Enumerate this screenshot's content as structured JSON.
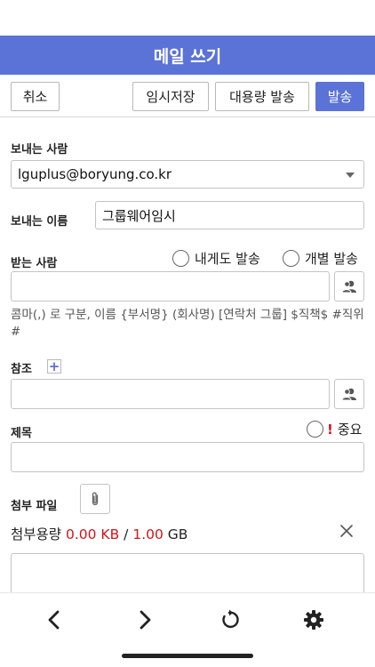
{
  "header": {
    "title": "메일 쓰기"
  },
  "toolbar": {
    "cancel_label": "취소",
    "draft_label": "임시저장",
    "bulk_send_label": "대용량 발송",
    "send_label": "발송"
  },
  "form": {
    "sender_label": "보내는 사람",
    "sender_value": "lguplus@boryung.co.kr",
    "sender_name_label": "보내는 이름",
    "sender_name_value": "그룹웨어임시",
    "recipient_label": "받는 사람",
    "send_to_me_label": "내게도 발송",
    "individual_send_label": "개별 발송",
    "recipient_value": "",
    "recipient_hint": "콤마(,) 로 구분, 이름 {부서명} (회사명) [연락처 그룹] $직책$ #직위#",
    "cc_label": "참조",
    "cc_add_symbol": "+",
    "cc_value": "",
    "subject_label": "제목",
    "important_mark": "!",
    "important_label": "중요",
    "subject_value": "",
    "attachment_label": "첨부 파일",
    "attachment_quota": {
      "label": "첨부용량",
      "used": "0.00 KB",
      "separator": "/",
      "limit": "1.00",
      "unit": "GB"
    },
    "body_value": ""
  },
  "icons": {
    "recipient_picker": "address-book-icon",
    "cc_picker": "address-book-icon",
    "attach": "paperclip-icon",
    "clear": "close-icon",
    "nav_back": "chevron-left-icon",
    "nav_forward": "chevron-right-icon",
    "reload": "reload-icon",
    "settings": "gear-icon"
  },
  "colors": {
    "accent": "#5b72d6",
    "alert": "#d0151b"
  }
}
